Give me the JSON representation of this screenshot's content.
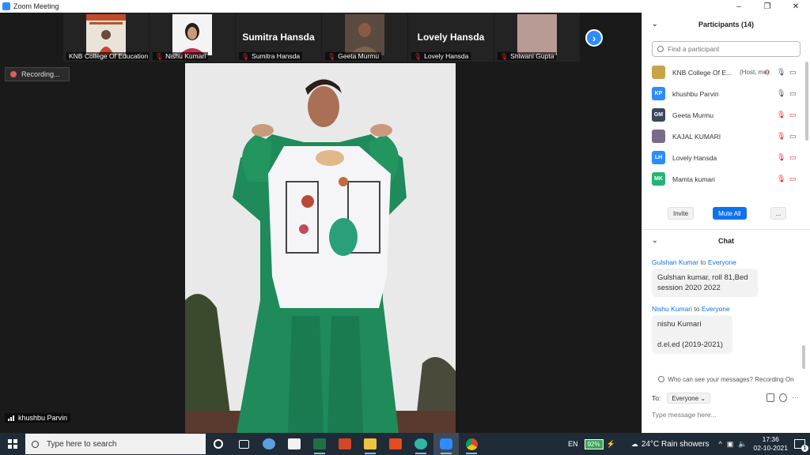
{
  "window": {
    "title": "Zoom Meeting",
    "controls": [
      "–",
      "❐",
      "✕"
    ]
  },
  "video_strip": [
    {
      "name": "KNB College Of Education",
      "kind": "video",
      "muted": false
    },
    {
      "name": "Nishu Kumari",
      "kind": "video",
      "muted": true
    },
    {
      "name": "Sumitra Hansda",
      "big_name": "Sumitra Hansda",
      "kind": "name",
      "muted": true
    },
    {
      "name": "Geeta Murmu",
      "kind": "video",
      "muted": true
    },
    {
      "name": "Lovely Hansda",
      "big_name": "Lovely Hansda",
      "kind": "name",
      "muted": true
    },
    {
      "name": "Shiwani Gupta",
      "kind": "video",
      "muted": true
    }
  ],
  "recording": {
    "label": "Recording..."
  },
  "active_speaker": {
    "name": "khushbu Parvin"
  },
  "participants": {
    "title": "Participants (14)",
    "search_placeholder": "Find a participant",
    "list": [
      {
        "name": "KNB College Of E...",
        "role": "(Host, me)",
        "initials": "",
        "avatar_color": "#c9a34a"
      },
      {
        "name": "khushbu Parvin",
        "role": "",
        "initials": "KP",
        "avatar_color": "#2d8cff"
      },
      {
        "name": "Geeta Murmu",
        "role": "",
        "initials": "GM",
        "avatar_color": "#3b4a5a"
      },
      {
        "name": "KAJAL KUMARI",
        "role": "",
        "initials": "",
        "avatar_color": "#7a6a8a"
      },
      {
        "name": "Lovely Hansda",
        "role": "",
        "initials": "LH",
        "avatar_color": "#2d8cff"
      },
      {
        "name": "Mamta kumari",
        "role": "",
        "initials": "MK",
        "avatar_color": "#22b573"
      }
    ],
    "buttons": {
      "invite": "Invite",
      "mute_all": "Mute All",
      "more": "..."
    }
  },
  "chat": {
    "title": "Chat",
    "messages": [
      {
        "from": "Gulshan Kumar",
        "to_word": "to",
        "to": "Everyone",
        "lines": [
          "Gulshan kumar, roll 81,Bed",
          "session 2020 2022"
        ]
      },
      {
        "from": "Nishu Kumari",
        "to_word": "to",
        "to": "Everyone",
        "lines": [
          "nishu Kumari",
          "",
          "d.el.ed  (2019-2021)"
        ]
      }
    ],
    "privacy_note": "Who can see your messages? Recording On",
    "to_label": "To:",
    "recipient": "Everyone",
    "input_placeholder": "Type message here..."
  },
  "taskbar": {
    "search_text": "Type here to search",
    "language": "EN",
    "battery": "92%",
    "weather": "24°C  Rain showers",
    "time": "17:36",
    "date": "02-10-2021",
    "notification_count": "1",
    "apps": [
      "task-view-icon",
      "edge-legacy-icon",
      "store-icon",
      "excel-icon",
      "powerpoint-icon",
      "file-explorer-icon",
      "office-icon",
      "edge-icon",
      "zoom-icon",
      "chrome-icon"
    ]
  }
}
